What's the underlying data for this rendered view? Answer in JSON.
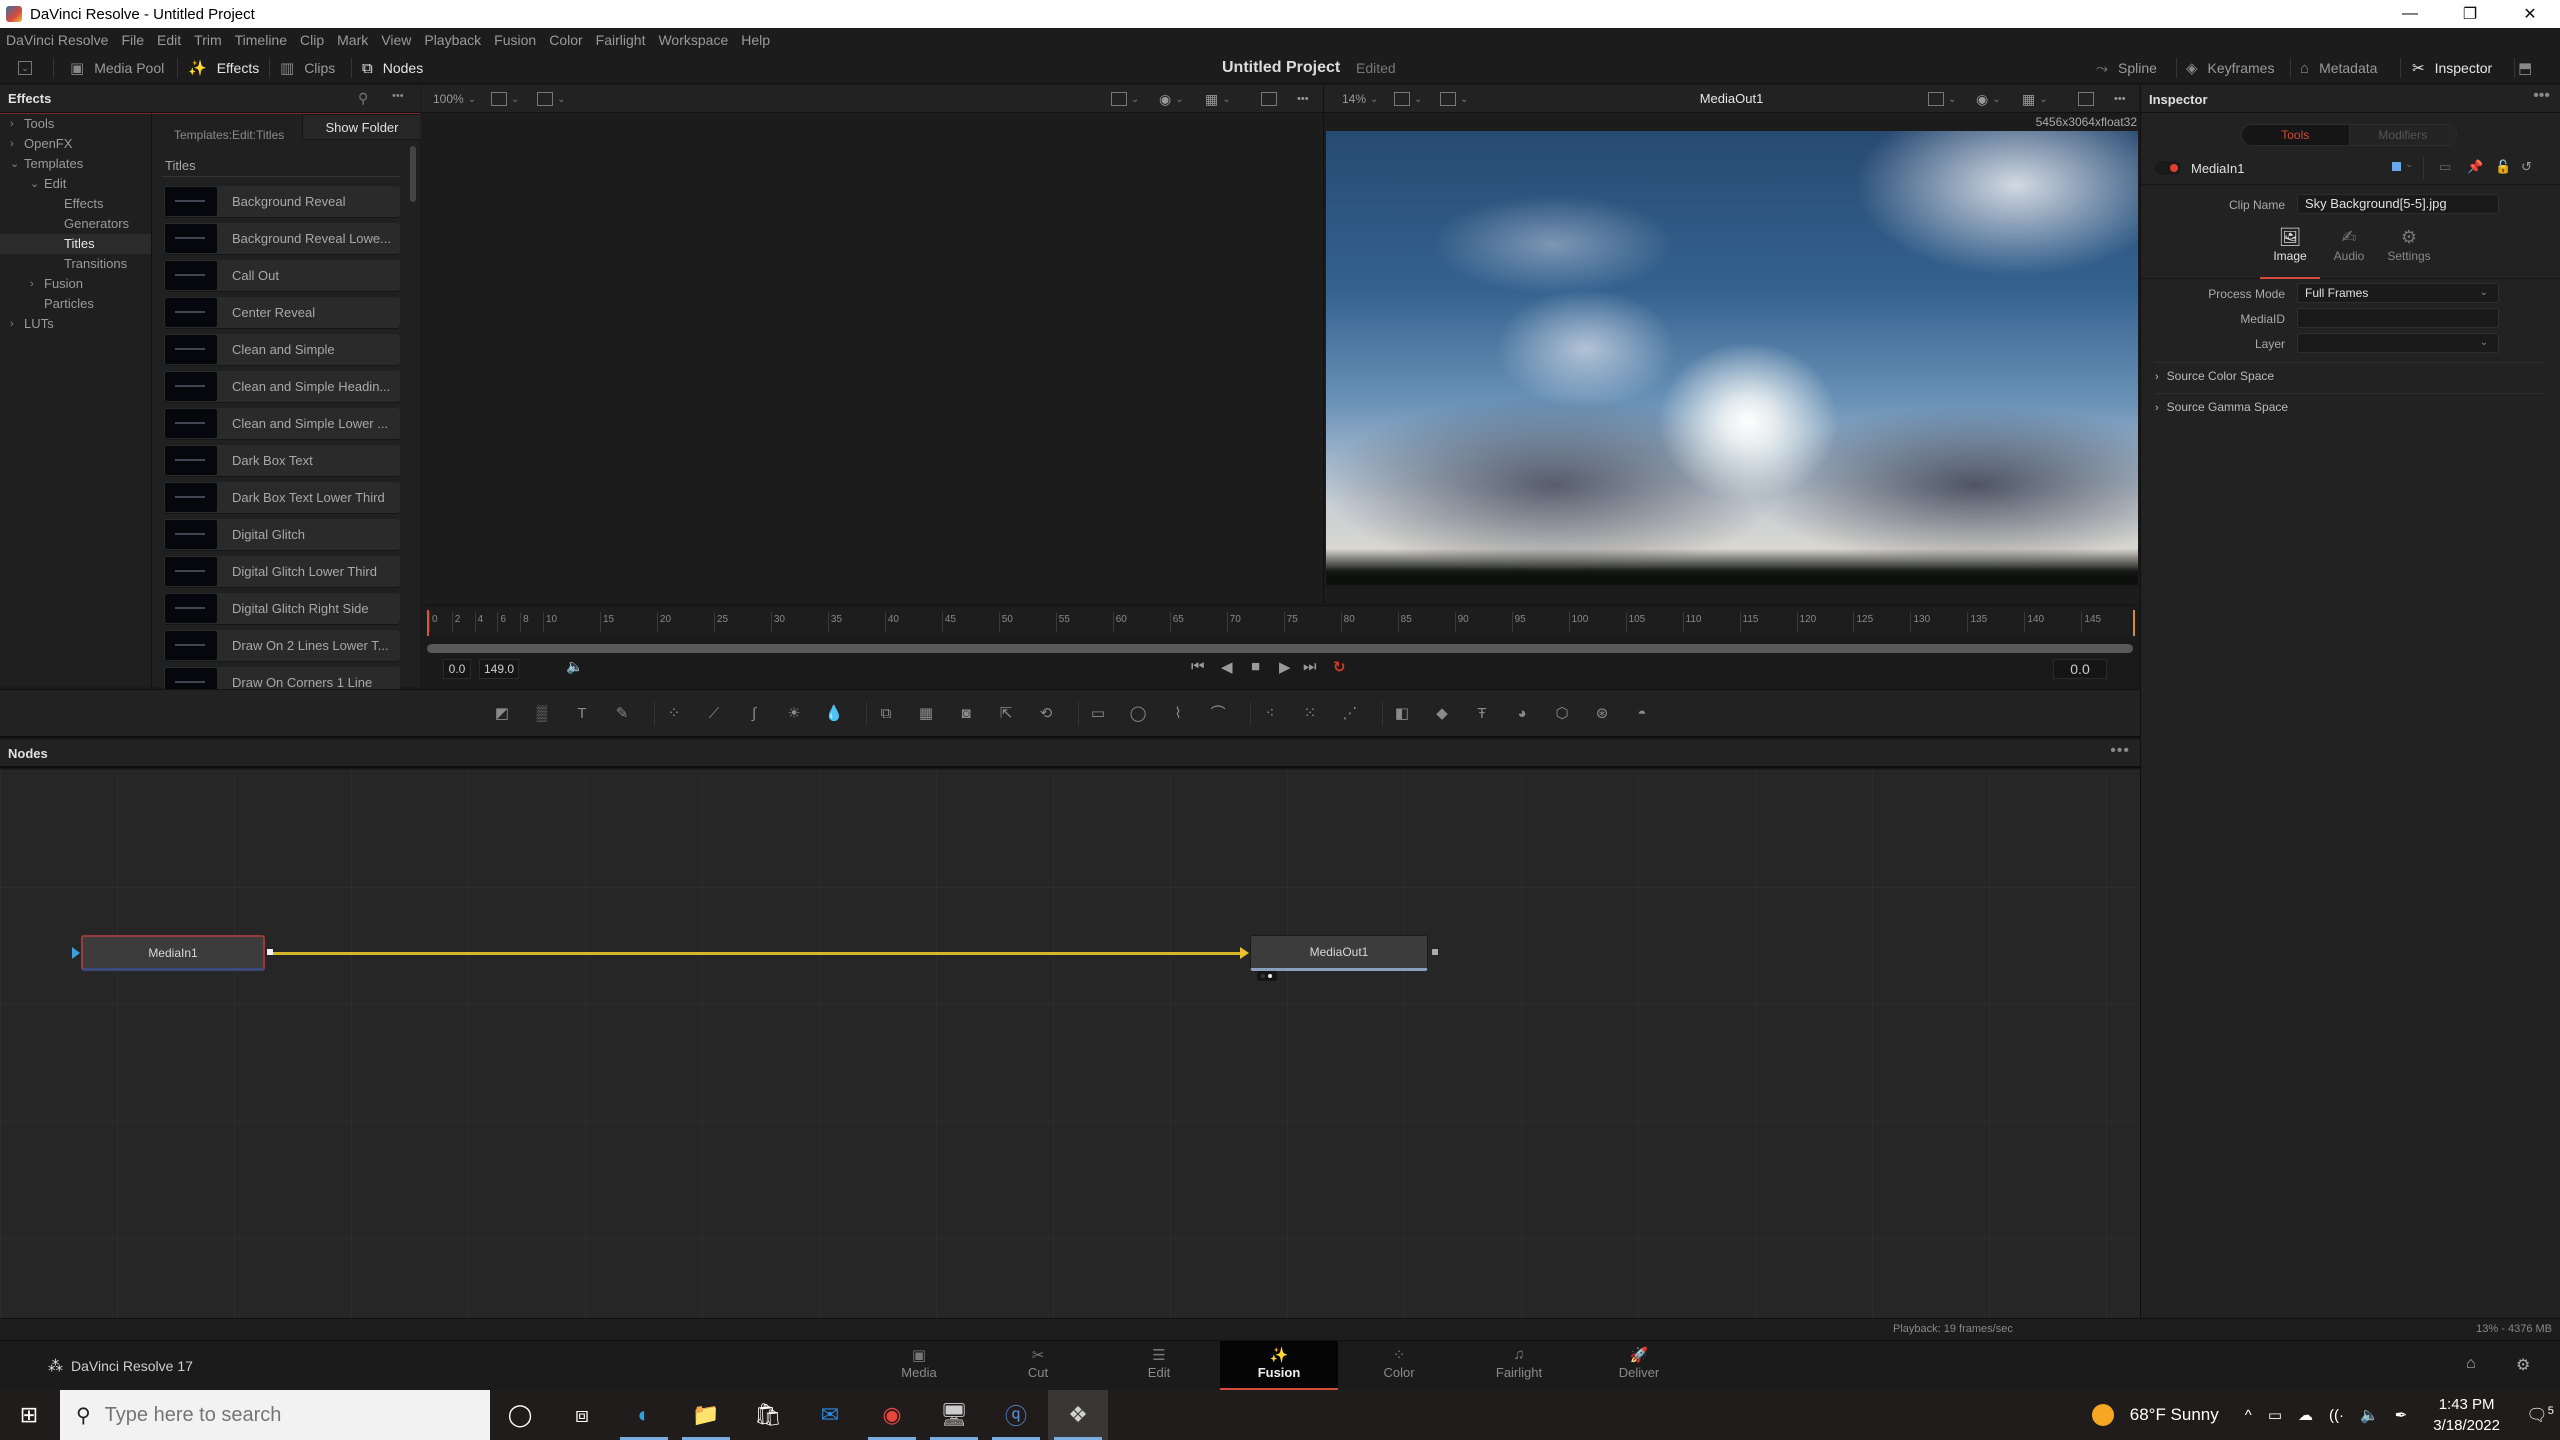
{
  "window": {
    "title": "DaVinci Resolve - Untitled Project",
    "controls": {
      "minimize": "—",
      "maximize": "❐",
      "close": "✕"
    }
  },
  "menu": [
    "DaVinci Resolve",
    "File",
    "Edit",
    "Trim",
    "Timeline",
    "Clip",
    "Mark",
    "View",
    "Playback",
    "Fusion",
    "Color",
    "Fairlight",
    "Workspace",
    "Help"
  ],
  "toolbar": {
    "left": [
      {
        "label": "Media Pool",
        "icon": "media-pool-icon",
        "glyph": "▣",
        "active": false
      },
      {
        "label": "Effects",
        "icon": "effects-wand-icon",
        "glyph": "✨",
        "active": true
      },
      {
        "label": "Clips",
        "icon": "clips-icon",
        "glyph": "▥",
        "active": false
      },
      {
        "label": "Nodes",
        "icon": "nodes-icon",
        "glyph": "⧉",
        "active": true
      }
    ],
    "project_title": "Untitled Project",
    "project_status": "Edited",
    "right": [
      {
        "label": "Spline",
        "icon": "spline-icon",
        "glyph": "⤳",
        "active": false
      },
      {
        "label": "Keyframes",
        "icon": "keyframes-icon",
        "glyph": "◈",
        "active": false
      },
      {
        "label": "Metadata",
        "icon": "metadata-icon",
        "glyph": "⌂",
        "active": false
      },
      {
        "label": "Inspector",
        "icon": "inspector-icon",
        "glyph": "✂",
        "active": true
      }
    ],
    "dropdown_glyph": "⌄",
    "fullscreen_glyph": "⬒"
  },
  "effects": {
    "title": "Effects",
    "search_glyph": "⚲",
    "more_glyph": "•••",
    "tree": [
      {
        "label": "Tools",
        "depth": 0,
        "chevron": "›",
        "selected": false
      },
      {
        "label": "OpenFX",
        "depth": 0,
        "chevron": "›",
        "selected": false
      },
      {
        "label": "Templates",
        "depth": 0,
        "chevron": "⌄",
        "selected": false
      },
      {
        "label": "Edit",
        "depth": 1,
        "chevron": "⌄",
        "selected": false
      },
      {
        "label": "Effects",
        "depth": 2,
        "chevron": "",
        "selected": false
      },
      {
        "label": "Generators",
        "depth": 2,
        "chevron": "",
        "selected": false
      },
      {
        "label": "Titles",
        "depth": 2,
        "chevron": "",
        "selected": true
      },
      {
        "label": "Transitions",
        "depth": 2,
        "chevron": "",
        "selected": false
      },
      {
        "label": "Fusion",
        "depth": 1,
        "chevron": "›",
        "selected": false
      },
      {
        "label": "Particles",
        "depth": 1,
        "chevron": "",
        "selected": false
      },
      {
        "label": "LUTs",
        "depth": 0,
        "chevron": "›",
        "selected": false
      }
    ],
    "path": "Templates:Edit:Titles",
    "show_folder": "Show Folder",
    "list_heading": "Titles",
    "items": [
      "Background Reveal",
      "Background Reveal Lowe...",
      "Call Out",
      "Center Reveal",
      "Clean and Simple",
      "Clean and Simple Headin...",
      "Clean and Simple Lower ...",
      "Dark Box Text",
      "Dark Box Text Lower Third",
      "Digital Glitch",
      "Digital Glitch Lower Third",
      "Digital Glitch Right Side",
      "Draw On 2 Lines Lower T...",
      "Draw On Corners 1 Line"
    ]
  },
  "viewer_left": {
    "zoom": "100%"
  },
  "viewer_right": {
    "zoom": "14%",
    "name": "MediaOut1",
    "resolution": "5456x3064xfloat32"
  },
  "ruler": {
    "ticks": [
      0,
      2,
      4,
      6,
      8,
      10,
      15,
      20,
      25,
      30,
      35,
      40,
      45,
      50,
      55,
      60,
      65,
      70,
      75,
      80,
      85,
      90,
      95,
      100,
      105,
      110,
      115,
      120,
      125,
      130,
      135,
      140,
      145
    ],
    "range_end": 149
  },
  "transport": {
    "start": "0.0",
    "end": "149.0",
    "current": "0.0",
    "audio_glyph": "🔈",
    "buttons": [
      {
        "name": "go-to-start",
        "glyph": "⏮"
      },
      {
        "name": "play-reverse",
        "glyph": "◀"
      },
      {
        "name": "stop",
        "glyph": "■"
      },
      {
        "name": "play-forward",
        "glyph": "▶"
      },
      {
        "name": "go-to-end",
        "glyph": "⏭"
      },
      {
        "name": "loop",
        "glyph": "↻"
      }
    ]
  },
  "tools_bar": [
    {
      "name": "background-tool",
      "glyph": "◩"
    },
    {
      "name": "fast-noise-tool",
      "glyph": "▒"
    },
    {
      "name": "text-tool",
      "glyph": "T"
    },
    {
      "name": "paint-tool",
      "glyph": "✎"
    },
    {
      "sep": true
    },
    {
      "name": "color-corrector-tool",
      "glyph": "⁘"
    },
    {
      "name": "color-curves-tool",
      "glyph": "⟋"
    },
    {
      "name": "hue-curves-tool",
      "glyph": "∫"
    },
    {
      "name": "brightness-contrast-tool",
      "glyph": "☀"
    },
    {
      "name": "blur-tool",
      "glyph": "💧"
    },
    {
      "sep": true
    },
    {
      "name": "merge-tool",
      "glyph": "⧉"
    },
    {
      "name": "channel-booleans-tool",
      "glyph": "▦"
    },
    {
      "name": "matte-control-tool",
      "glyph": "◙"
    },
    {
      "name": "resize-tool",
      "glyph": "⇱"
    },
    {
      "name": "transform-tool",
      "glyph": "⟲"
    },
    {
      "sep": true
    },
    {
      "name": "rectangle-mask-tool",
      "glyph": "▭"
    },
    {
      "name": "ellipse-mask-tool",
      "glyph": "◯"
    },
    {
      "name": "polygon-mask-tool",
      "glyph": "⌇"
    },
    {
      "name": "bspline-mask-tool",
      "glyph": "⌒"
    },
    {
      "sep": true
    },
    {
      "name": "particle-emitter-tool",
      "glyph": "⁖"
    },
    {
      "name": "particle-render-tool",
      "glyph": "⁙"
    },
    {
      "name": "p-render-tool",
      "glyph": "⋰"
    },
    {
      "sep": true
    },
    {
      "name": "image-plane-3d-tool",
      "glyph": "◧"
    },
    {
      "name": "shape-3d-tool",
      "glyph": "◆"
    },
    {
      "name": "text-3d-tool",
      "glyph": "Ŧ"
    },
    {
      "name": "merge-3d-tool",
      "glyph": "◕"
    },
    {
      "name": "renderer-3d-tool",
      "glyph": "⬡"
    },
    {
      "name": "camera-3d-tool",
      "glyph": "⊛"
    },
    {
      "name": "spotlight-3d-tool",
      "glyph": "◓"
    }
  ],
  "nodes": {
    "title": "Nodes",
    "more_glyph": "•••",
    "items": [
      {
        "id": "mediain",
        "label": "MediaIn1"
      },
      {
        "id": "mediaout",
        "label": "MediaOut1"
      }
    ]
  },
  "status": {
    "playback": "Playback: 19 frames/sec",
    "memory": "13% - 4376 MB"
  },
  "inspector": {
    "title": "Inspector",
    "more_glyph": "•••",
    "segments": [
      "Tools",
      "Modifiers"
    ],
    "tool_name": "MediaIn1",
    "tool_color": "#6aa8e8",
    "clip_name_label": "Clip Name",
    "clip_name_value": "Sky Background[5-5].jpg",
    "tabs": [
      {
        "label": "Image",
        "glyph": "🖼",
        "active": true
      },
      {
        "label": "Audio",
        "glyph": "✍",
        "active": false
      },
      {
        "label": "Settings",
        "glyph": "⚙",
        "active": false
      }
    ],
    "fields": [
      {
        "label": "Process Mode",
        "value": "Full Frames",
        "dropdown": true
      },
      {
        "label": "MediaID",
        "value": "",
        "dropdown": false
      },
      {
        "label": "Layer",
        "value": "",
        "dropdown": true
      }
    ],
    "sections": [
      "Source Color Space",
      "Source Gamma Space"
    ]
  },
  "pages": {
    "brand": "DaVinci Resolve 17",
    "items": [
      {
        "label": "Media",
        "glyph": "▣",
        "active": false
      },
      {
        "label": "Cut",
        "glyph": "✂",
        "active": false
      },
      {
        "label": "Edit",
        "glyph": "☰",
        "active": false
      },
      {
        "label": "Fusion",
        "glyph": "✨",
        "active": true
      },
      {
        "label": "Color",
        "glyph": "⁘",
        "active": false
      },
      {
        "label": "Fairlight",
        "glyph": "♫",
        "active": false
      },
      {
        "label": "Deliver",
        "glyph": "🚀",
        "active": false
      }
    ],
    "home_glyph": "⌂",
    "settings_glyph": "⚙"
  },
  "taskbar": {
    "search_placeholder": "Type here to search",
    "apps": [
      {
        "name": "cortana",
        "glyph": "◯",
        "color": "#ffffff",
        "running": false
      },
      {
        "name": "task-view",
        "glyph": "⧈",
        "color": "#ffffff",
        "running": false
      },
      {
        "name": "edge",
        "glyph": "◐",
        "color": "#2fa0e0",
        "running": true
      },
      {
        "name": "file-explorer",
        "glyph": "📁",
        "color": "#f4c542",
        "running": true
      },
      {
        "name": "microsoft-store",
        "glyph": "🛍",
        "color": "#ffffff",
        "running": false
      },
      {
        "name": "mail",
        "glyph": "✉",
        "color": "#2a8ae0",
        "running": false
      },
      {
        "name": "chrome",
        "glyph": "◉",
        "color": "#e8453c",
        "running": true
      },
      {
        "name": "system-monitor",
        "glyph": "🖥",
        "color": "#cccccc",
        "running": true
      },
      {
        "name": "qbittorrent",
        "glyph": "ⓠ",
        "color": "#5b8ed6",
        "running": true
      },
      {
        "name": "davinci-resolve",
        "glyph": "❖",
        "color": "#d0d0d0",
        "running": true,
        "active": true
      }
    ],
    "weather": "68°F  Sunny",
    "tray_icons": [
      {
        "name": "show-hidden-icons",
        "glyph": "^"
      },
      {
        "name": "battery",
        "glyph": "▭"
      },
      {
        "name": "onedrive",
        "glyph": "☁"
      },
      {
        "name": "wifi",
        "glyph": "((·"
      },
      {
        "name": "volume",
        "glyph": "🔈"
      },
      {
        "name": "pen",
        "glyph": "✒"
      }
    ],
    "time": "1:43 PM",
    "date": "3/18/2022",
    "notification_count": "5"
  }
}
